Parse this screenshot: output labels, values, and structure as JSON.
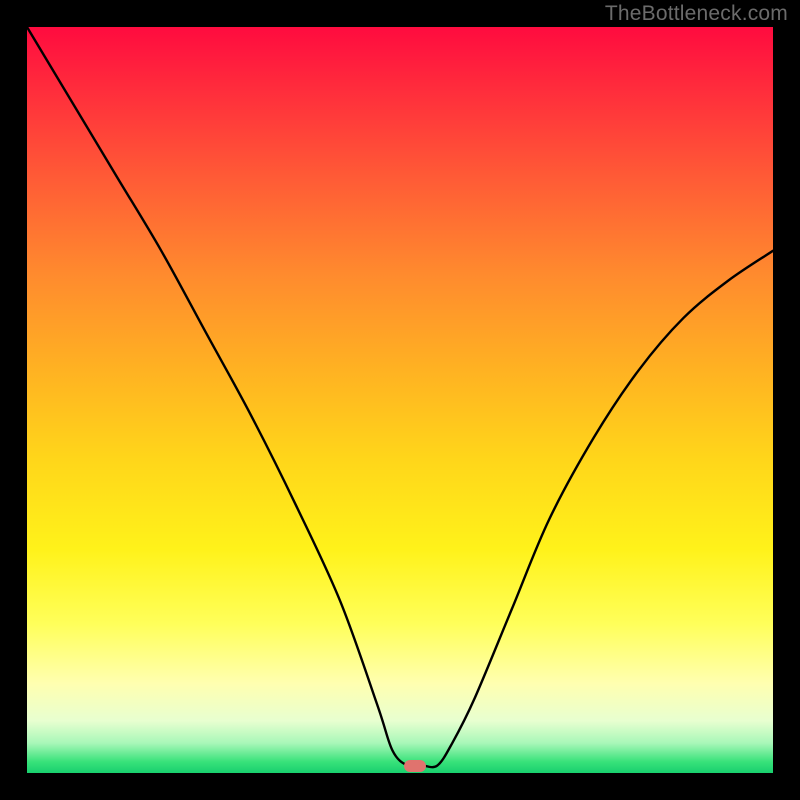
{
  "watermark": "TheBottleneck.com",
  "colors": {
    "frame": "#000000",
    "curve": "#000000",
    "marker": "#e0736e",
    "gradient_top": "#ff0b3f",
    "gradient_bottom": "#18cf6e"
  },
  "chart_data": {
    "type": "line",
    "title": "",
    "xlabel": "",
    "ylabel": "",
    "xlim": [
      0,
      100
    ],
    "ylim": [
      0,
      100
    ],
    "grid": false,
    "legend": false,
    "x": [
      0,
      6,
      12,
      18,
      24,
      30,
      36,
      42,
      47,
      49,
      51,
      53,
      55,
      57,
      60,
      65,
      70,
      76,
      82,
      88,
      94,
      100
    ],
    "values": [
      100,
      90,
      80,
      70,
      59,
      48,
      36,
      23,
      9,
      3,
      1,
      1,
      1,
      4,
      10,
      22,
      34,
      45,
      54,
      61,
      66,
      70
    ],
    "minimum": {
      "x": 52,
      "y": 1
    },
    "annotations": []
  }
}
